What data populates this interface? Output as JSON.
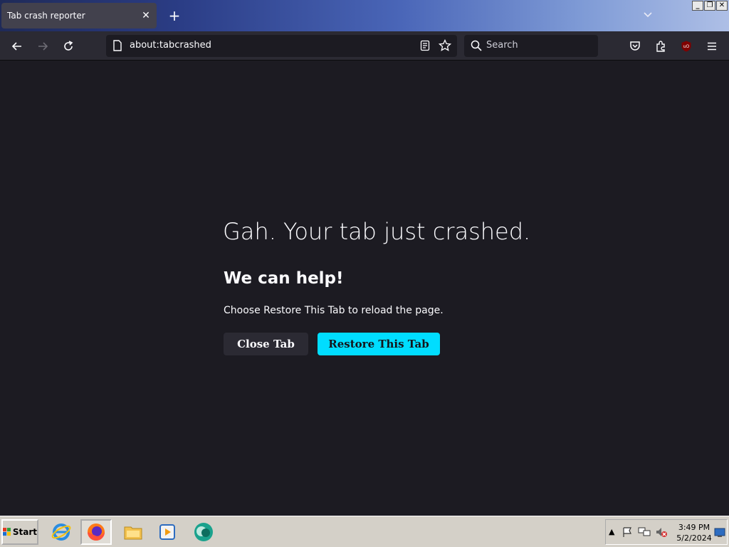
{
  "window": {
    "tab_title": "Tab crash reporter",
    "tab_close_glyph": "✕",
    "new_tab_glyph": "+",
    "tab_list_glyph": "⌄",
    "controls": {
      "minimize": "_",
      "restore": "❐",
      "close": "✕"
    }
  },
  "toolbar": {
    "url": "about:tabcrashed",
    "search_placeholder": "Search",
    "icons": [
      "back-icon",
      "forward-icon",
      "reload-icon",
      "page-icon",
      "reader-view-icon",
      "bookmark-star-icon",
      "search-icon",
      "pocket-icon",
      "extensions-icon",
      "ublock-icon",
      "menu-icon"
    ]
  },
  "content": {
    "title": "Gah. Your tab just crashed.",
    "subtitle": "We can help!",
    "description": "Choose Restore This Tab to reload the page.",
    "close_button": "Close Tab",
    "restore_button": "Restore This Tab"
  },
  "taskbar": {
    "start_label": "Start",
    "apps": [
      "internet-explorer-icon",
      "firefox-icon",
      "file-explorer-icon",
      "media-player-icon",
      "messenger-icon"
    ],
    "time": "3:49 PM",
    "date": "5/2/2024"
  },
  "colors": {
    "page_bg": "#1c1b22",
    "toolbar_bg": "#2b2a33",
    "accent": "#00ddff",
    "text": "#fbfbfe"
  }
}
